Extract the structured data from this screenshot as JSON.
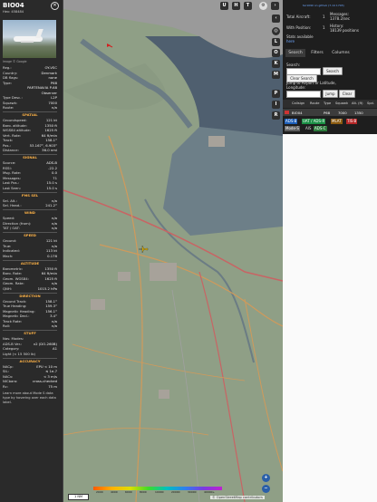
{
  "left_panel": {
    "callsign": "BIO04",
    "hex": "Hex: 458484",
    "image_credit": "Image © Google",
    "info_rows": [
      {
        "k": "Reg.:",
        "v": "OY-VSC"
      },
      {
        "k": "Country:",
        "v": "Denmark"
      },
      {
        "k": "DB flags:",
        "v": "none"
      },
      {
        "k": "Type:",
        "v": "P68"
      },
      {
        "k": "",
        "v": "PARTENAVIA P-68"
      },
      {
        "k": "",
        "v": "Observer"
      },
      {
        "k": "Type Desc.:",
        "v": "L2P"
      },
      {
        "k": "Squawk:",
        "v": "7000"
      },
      {
        "k": "Route:",
        "v": "n/a"
      }
    ],
    "sections": {
      "spatial": "SPATIAL",
      "signal": "SIGNAL",
      "fms_sel": "FMS SEL",
      "wind": "WIND",
      "speed": "SPEED",
      "altitude": "ALTITUDE",
      "direction": "DIRECTION",
      "stuff": "STUFF",
      "accuracy": "ACCURACY"
    },
    "spatial_rows": [
      {
        "k": "Groundspeed:",
        "v": "121 kt"
      },
      {
        "k": "Baro. altitude:",
        "v": "1350 ft"
      },
      {
        "k": "WGS84 altitude:",
        "v": "1625 ft"
      },
      {
        "k": "Vert. Rate:",
        "v": "64 ft/min"
      },
      {
        "k": "Track:",
        "v": "158.1°"
      },
      {
        "k": "Pos.:",
        "v": "53.167°, 6.903°"
      },
      {
        "k": "Distance:",
        "v": "36.0 nmi"
      }
    ],
    "signal_rows": [
      {
        "k": "Source:",
        "v": "ADS-B"
      },
      {
        "k": "RSSI:",
        "v": "-22.2"
      },
      {
        "k": "Msg. Rate:",
        "v": "0.0"
      },
      {
        "k": "Messages:",
        "v": "71"
      },
      {
        "k": "Last Pos.:",
        "v": "15.0 s"
      },
      {
        "k": "Last Seen:",
        "v": "15.0 s"
      }
    ],
    "fms_rows": [
      {
        "k": "Sel. Alt.:",
        "v": "n/a"
      },
      {
        "k": "Sel. Head.:",
        "v": "241.2°"
      }
    ],
    "wind_rows": [
      {
        "k": "Speed:",
        "v": "n/a"
      },
      {
        "k": "Direction (from):",
        "v": "n/a"
      },
      {
        "k": "TAT / OAT:",
        "v": "n/a"
      }
    ],
    "speed_rows": [
      {
        "k": "Ground:",
        "v": "121 kt"
      },
      {
        "k": "True:",
        "v": "n/a"
      },
      {
        "k": "Indicated:",
        "v": "113 kt"
      },
      {
        "k": "Mach:",
        "v": "0.176"
      }
    ],
    "altitude_rows": [
      {
        "k": "Barometric:",
        "v": "1350 ft"
      },
      {
        "k": "Baro. Rate:",
        "v": "64 ft/min"
      },
      {
        "k": "Geom. WGS84:",
        "v": "1625 ft"
      },
      {
        "k": "Geom. Rate:",
        "v": "n/a"
      },
      {
        "k": "QNH:",
        "v": "1015.2 hPa"
      }
    ],
    "direction_rows": [
      {
        "k": "Ground Track:",
        "v": "158.1°"
      },
      {
        "k": "True Heading:",
        "v": "159.3°"
      },
      {
        "k": "Magnetic Heading:",
        "v": "156.1°"
      },
      {
        "k": "Magnetic Decl.:",
        "v": "3.4°"
      },
      {
        "k": "Track Rate:",
        "v": "n/a"
      },
      {
        "k": "Roll:",
        "v": "n/a"
      }
    ],
    "stuff_rows": [
      {
        "k": "Nav. Modes:",
        "v": ""
      },
      {
        "k": "ADS-B Ver.:",
        "v": "v2 (DO-260B)"
      },
      {
        "k": "Category:",
        "v": "A1"
      },
      {
        "k": "Light (< 15 500 lb)",
        "v": ""
      }
    ],
    "accuracy_rows": [
      {
        "k": "NACp:",
        "v": "EPU < 10 m"
      },
      {
        "k": "SIL:",
        "v": "≤ 1e-7"
      },
      {
        "k": "NACv:",
        "v": "< 3 m/s"
      },
      {
        "k": "NICbaro:",
        "v": "cross-checked"
      },
      {
        "k": "Rc:",
        "v": "75 m"
      }
    ],
    "footer_note": "Learn more about Mode S data type by hovering over each data label."
  },
  "map": {
    "top_buttons": [
      "U",
      "H",
      "T"
    ],
    "side_buttons": [
      "L",
      "O",
      "K",
      "M",
      "P",
      "I",
      "R"
    ],
    "scale_label": "1 NM",
    "attribution": "© OpenStreetMap contributors",
    "zoom_in": "+",
    "zoom_out": "−",
    "colorbar_labels": [
      "2000",
      "4000",
      "6000",
      "8000",
      "10000",
      "20000",
      "30000",
      "40000+"
    ]
  },
  "right_panel": {
    "update_link": "tar1090 on github (7.14 1703)",
    "total_aircraft_label": "Total Aircraft:",
    "total_aircraft_value": "1",
    "with_position_label": "With Position:",
    "with_position_value": "1",
    "messages_label": "Messages:",
    "messages_value": "1378.2/sec",
    "history_label": "History:",
    "history_value": "18139 positions",
    "stats_label": "Stats available",
    "stats_link": "here",
    "tabs": [
      "Search",
      "Filters",
      "Columns"
    ],
    "search_label": "Search:",
    "search_button": "Search",
    "clear_search_button": "Clear Search",
    "jump_label": "Jump to Airport or Latitude, Longitude:",
    "jump_button": "Jump",
    "clear_button": "Clear",
    "table_headers": [
      "Callsign",
      "Route",
      "Type",
      "Squawk",
      "Alt. (ft)",
      "Spd."
    ],
    "table_row": {
      "callsign": "BIO04",
      "route": "",
      "type": "P68",
      "squawk": "7000",
      "alt": "1350",
      "spd": ""
    },
    "source_tags": [
      "ADS-B",
      "UAT / ADS-R",
      "MLAT",
      "TIS-B",
      "Mode-S",
      "AIS",
      "ADS-C"
    ],
    "colors": {
      "ads_b": "#1e5fb8",
      "uat": "#1b8f45",
      "mlat": "#7a4a00",
      "tisb": "#b52828",
      "modes": "#6a6a6a",
      "adsc": "#2b7a3b"
    }
  }
}
